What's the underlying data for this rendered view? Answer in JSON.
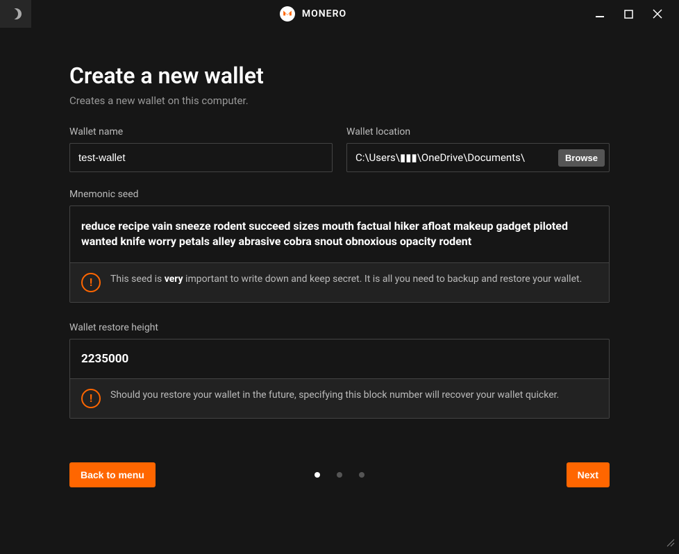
{
  "titlebar": {
    "app_name": "MONERO"
  },
  "page": {
    "title": "Create a new wallet",
    "subtitle": "Creates a new wallet on this computer."
  },
  "fields": {
    "wallet_name": {
      "label": "Wallet name",
      "value": "test-wallet"
    },
    "wallet_location": {
      "label": "Wallet location",
      "value": "C:\\Users\\▮▮▮\\OneDrive\\Documents\\",
      "browse_label": "Browse"
    },
    "mnemonic": {
      "label": "Mnemonic seed",
      "seed": "reduce recipe vain sneeze rodent succeed sizes mouth factual hiker afloat makeup gadget piloted wanted knife worry petals alley abrasive cobra snout obnoxious opacity rodent",
      "notice_pre": "This seed is ",
      "notice_bold": "very",
      "notice_post": " important to write down and keep secret. It is all you need to backup and restore your wallet."
    },
    "restore_height": {
      "label": "Wallet restore height",
      "value": "2235000",
      "notice": "Should you restore your wallet in the future, specifying this block number will recover your wallet quicker."
    }
  },
  "buttons": {
    "back": "Back to menu",
    "next": "Next"
  },
  "colors": {
    "accent": "#ff6600",
    "background": "#161616"
  }
}
